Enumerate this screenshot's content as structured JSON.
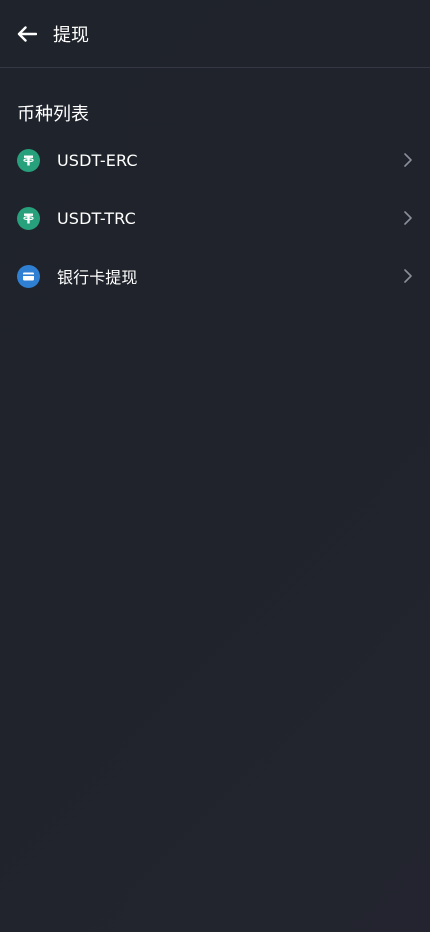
{
  "header": {
    "title": "提现",
    "back_icon": "arrow-left-icon"
  },
  "section": {
    "title": "币种列表"
  },
  "items": [
    {
      "label": "USDT-ERC",
      "icon": "tether-icon",
      "icon_color": "#26a17b"
    },
    {
      "label": "USDT-TRC",
      "icon": "tether-icon",
      "icon_color": "#26a17b"
    },
    {
      "label": "银行卡提现",
      "icon": "bank-card-icon",
      "icon_color": "#2f7fd3"
    }
  ],
  "colors": {
    "background": "#20232c",
    "divider": "#353842",
    "text": "#ffffff",
    "chevron": "#8a8e98"
  }
}
